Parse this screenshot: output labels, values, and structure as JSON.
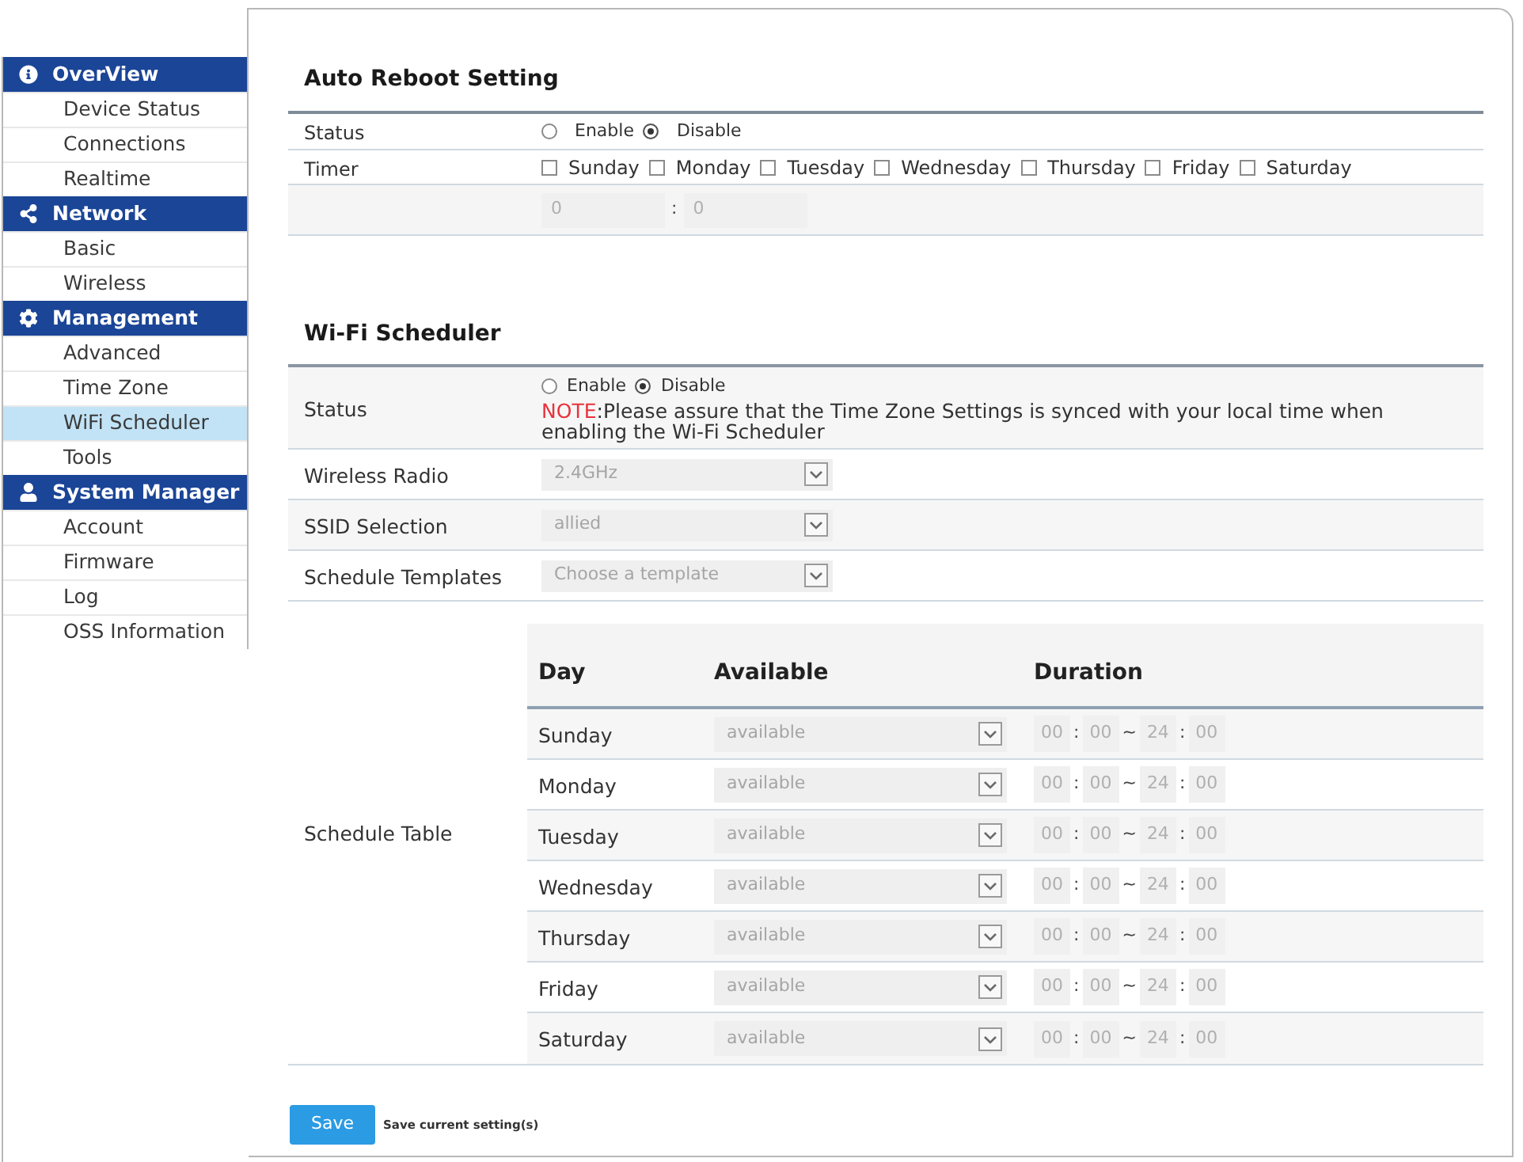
{
  "sidebar": {
    "sections": [
      {
        "title": "OverView",
        "items": [
          {
            "label": "Device Status",
            "selected": false
          },
          {
            "label": "Connections",
            "selected": false
          },
          {
            "label": "Realtime",
            "selected": false
          }
        ]
      },
      {
        "title": "Network",
        "items": [
          {
            "label": "Basic",
            "selected": false
          },
          {
            "label": "Wireless",
            "selected": false
          }
        ]
      },
      {
        "title": "Management",
        "items": [
          {
            "label": "Advanced",
            "selected": false
          },
          {
            "label": "Time Zone",
            "selected": false
          },
          {
            "label": "WiFi Scheduler",
            "selected": true
          },
          {
            "label": "Tools",
            "selected": false
          }
        ]
      },
      {
        "title": "System Manager",
        "items": [
          {
            "label": "Account",
            "selected": false
          },
          {
            "label": "Firmware",
            "selected": false
          },
          {
            "label": "Log",
            "selected": false
          },
          {
            "label": "OSS Information",
            "selected": false
          }
        ]
      }
    ]
  },
  "auto_reboot": {
    "title": "Auto Reboot Setting",
    "status": {
      "label": "Status",
      "options": [
        {
          "label": "Enable",
          "selected": false
        },
        {
          "label": "Disable",
          "selected": true
        }
      ]
    },
    "timer": {
      "label": "Timer",
      "days": [
        {
          "label": "Sunday",
          "checked": false
        },
        {
          "label": "Monday",
          "checked": false
        },
        {
          "label": "Tuesday",
          "checked": false
        },
        {
          "label": "Wednesday",
          "checked": false
        },
        {
          "label": "Thursday",
          "checked": false
        },
        {
          "label": "Friday",
          "checked": false
        },
        {
          "label": "Saturday",
          "checked": false
        }
      ],
      "time": [
        {
          "kind": "input",
          "text": "0",
          "disabled": true
        },
        {
          "kind": "separator",
          "text": ":"
        },
        {
          "kind": "input",
          "text": "0",
          "disabled": true
        }
      ]
    }
  },
  "wifi_scheduler": {
    "title": "Wi-Fi Scheduler",
    "status": {
      "label": "Status",
      "options": [
        {
          "label": "Enable",
          "selected": false
        },
        {
          "label": "Disable",
          "selected": true
        }
      ],
      "note": {
        "label": "NOTE",
        "text": ":Please assure that the Time Zone Settings is synced with your local time when enabling the Wi-Fi Scheduler"
      }
    },
    "fields": [
      {
        "label": "Wireless Radio",
        "value": "2.4GHz",
        "disabled": true
      },
      {
        "label": "SSID Selection",
        "value": "allied",
        "disabled": true
      },
      {
        "label": "Schedule Templates",
        "value": "Choose a template",
        "disabled": true
      }
    ],
    "schedule_table": {
      "label": "Schedule Table",
      "columns": [
        "Day",
        "Available",
        "Duration"
      ],
      "rows": [
        {
          "day": "Sunday",
          "available": "available",
          "disabled": true,
          "duration": [
            {
              "kind": "input",
              "text": "00"
            },
            {
              "kind": "separator",
              "text": ":"
            },
            {
              "kind": "input",
              "text": "00"
            },
            {
              "kind": "separator",
              "text": "~"
            },
            {
              "kind": "input",
              "text": "24"
            },
            {
              "kind": "separator",
              "text": ":"
            },
            {
              "kind": "input",
              "text": "00"
            }
          ]
        },
        {
          "day": "Monday",
          "available": "available",
          "disabled": true,
          "duration": [
            {
              "kind": "input",
              "text": "00"
            },
            {
              "kind": "separator",
              "text": ":"
            },
            {
              "kind": "input",
              "text": "00"
            },
            {
              "kind": "separator",
              "text": "~"
            },
            {
              "kind": "input",
              "text": "24"
            },
            {
              "kind": "separator",
              "text": ":"
            },
            {
              "kind": "input",
              "text": "00"
            }
          ]
        },
        {
          "day": "Tuesday",
          "available": "available",
          "disabled": true,
          "duration": [
            {
              "kind": "input",
              "text": "00"
            },
            {
              "kind": "separator",
              "text": ":"
            },
            {
              "kind": "input",
              "text": "00"
            },
            {
              "kind": "separator",
              "text": "~"
            },
            {
              "kind": "input",
              "text": "24"
            },
            {
              "kind": "separator",
              "text": ":"
            },
            {
              "kind": "input",
              "text": "00"
            }
          ]
        },
        {
          "day": "Wednesday",
          "available": "available",
          "disabled": true,
          "duration": [
            {
              "kind": "input",
              "text": "00"
            },
            {
              "kind": "separator",
              "text": ":"
            },
            {
              "kind": "input",
              "text": "00"
            },
            {
              "kind": "separator",
              "text": "~"
            },
            {
              "kind": "input",
              "text": "24"
            },
            {
              "kind": "separator",
              "text": ":"
            },
            {
              "kind": "input",
              "text": "00"
            }
          ]
        },
        {
          "day": "Thursday",
          "available": "available",
          "disabled": true,
          "duration": [
            {
              "kind": "input",
              "text": "00"
            },
            {
              "kind": "separator",
              "text": ":"
            },
            {
              "kind": "input",
              "text": "00"
            },
            {
              "kind": "separator",
              "text": "~"
            },
            {
              "kind": "input",
              "text": "24"
            },
            {
              "kind": "separator",
              "text": ":"
            },
            {
              "kind": "input",
              "text": "00"
            }
          ]
        },
        {
          "day": "Friday",
          "available": "available",
          "disabled": true,
          "duration": [
            {
              "kind": "input",
              "text": "00"
            },
            {
              "kind": "separator",
              "text": ":"
            },
            {
              "kind": "input",
              "text": "00"
            },
            {
              "kind": "separator",
              "text": "~"
            },
            {
              "kind": "input",
              "text": "24"
            },
            {
              "kind": "separator",
              "text": ":"
            },
            {
              "kind": "input",
              "text": "00"
            }
          ]
        },
        {
          "day": "Saturday",
          "available": "available",
          "disabled": true,
          "duration": [
            {
              "kind": "input",
              "text": "00"
            },
            {
              "kind": "separator",
              "text": ":"
            },
            {
              "kind": "input",
              "text": "00"
            },
            {
              "kind": "separator",
              "text": "~"
            },
            {
              "kind": "input",
              "text": "24"
            },
            {
              "kind": "separator",
              "text": ":"
            },
            {
              "kind": "input",
              "text": "00"
            }
          ]
        }
      ]
    }
  },
  "save": {
    "button": "Save",
    "hint": "Save current setting(s)"
  }
}
